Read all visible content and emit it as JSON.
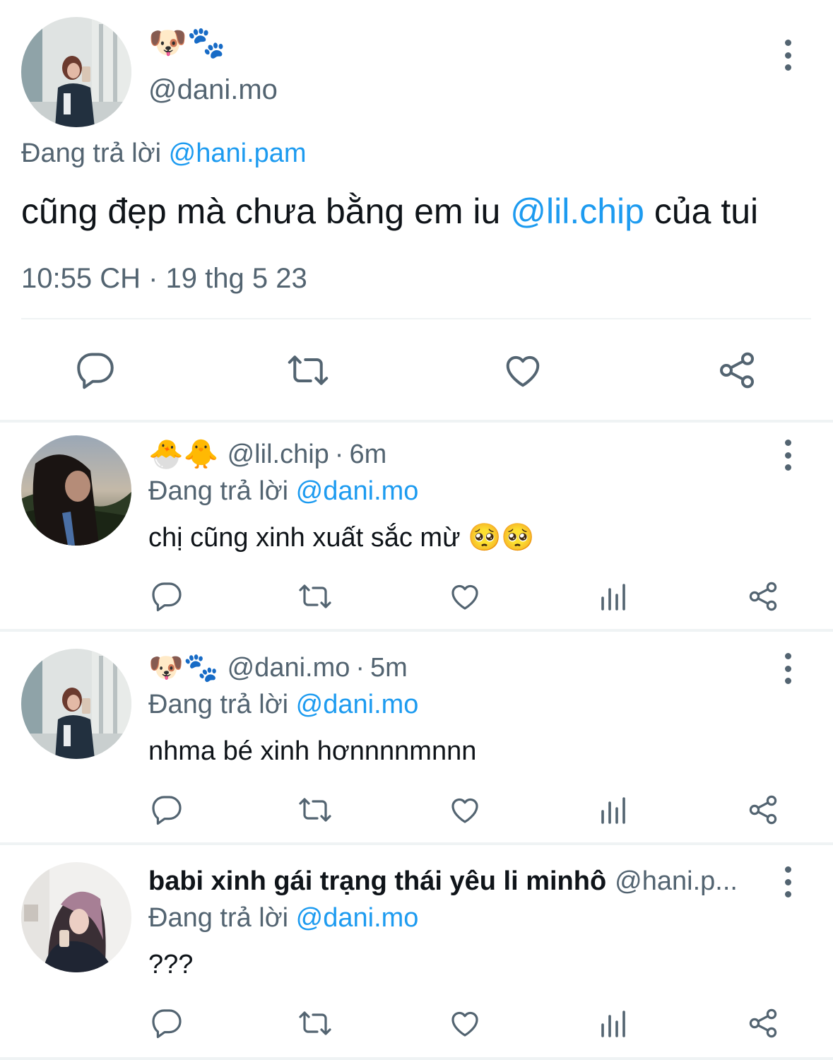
{
  "main": {
    "emoji_name": "🐶🐾",
    "handle": "@dani.mo",
    "reply_prefix": "Đang trả lời ",
    "reply_to": "@hani.pam",
    "text_before": "cũng đẹp mà chưa bằng em iu ",
    "text_mention": "@lil.chip",
    "text_after": " của tui",
    "timestamp": "10:55 CH · 19 thg 5 23",
    "actions": [
      "reply-icon",
      "retweet-icon",
      "like-icon",
      "share-icon"
    ]
  },
  "replies": [
    {
      "emoji_name": "🐣🐥",
      "display_name": "",
      "handle": "@lil.chip",
      "dot": "·",
      "time": "6m",
      "reply_prefix": "Đang trả lời ",
      "reply_to": "@dani.mo",
      "text": "chị cũng xinh xuất sắc mừ 🥺🥺"
    },
    {
      "emoji_name": "🐶🐾",
      "display_name": "",
      "handle": "@dani.mo",
      "dot": "·",
      "time": "5m",
      "reply_prefix": "Đang trả lời ",
      "reply_to": "@dani.mo",
      "text": "nhma bé xinh hơnnnnmnnn"
    },
    {
      "emoji_name": "",
      "display_name": "babi xinh gái trạng thái yêu li minhô",
      "handle": "@hani.p...",
      "dot": "",
      "time": "",
      "reply_prefix": "Đang trả lời ",
      "reply_to": "@dani.mo",
      "text": "???"
    }
  ],
  "colors": {
    "text": "#0f1419",
    "secondary": "#536471",
    "accent": "#1d9bf0",
    "divider": "#eff3f4"
  },
  "reply_actions": [
    "reply-icon",
    "retweet-icon",
    "like-icon",
    "views-icon",
    "share-icon"
  ]
}
